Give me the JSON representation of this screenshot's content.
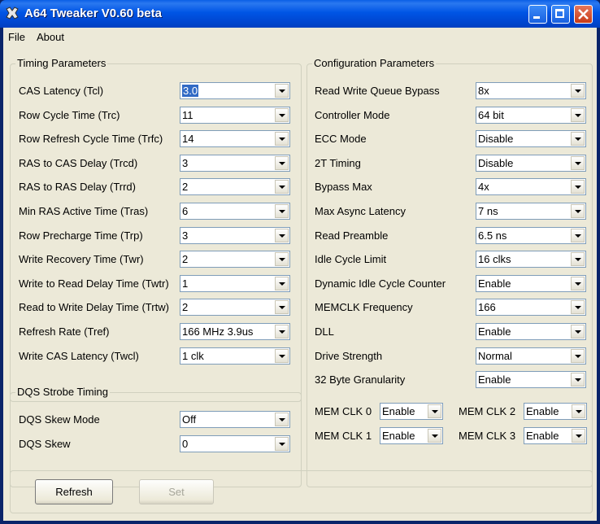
{
  "window": {
    "title": "A64 Tweaker V0.60 beta"
  },
  "menu": [
    "File",
    "About"
  ],
  "timing": {
    "title": "Timing Parameters",
    "rows": [
      {
        "label": "CAS Latency (Tcl)",
        "value": "3.0"
      },
      {
        "label": "Row Cycle Time (Trc)",
        "value": "11"
      },
      {
        "label": "Row Refresh Cycle Time (Trfc)",
        "value": "14"
      },
      {
        "label": "RAS to CAS Delay (Trcd)",
        "value": "3"
      },
      {
        "label": "RAS to RAS Delay (Trrd)",
        "value": "2"
      },
      {
        "label": "Min RAS Active Time (Tras)",
        "value": "6"
      },
      {
        "label": "Row Precharge Time (Trp)",
        "value": "3"
      },
      {
        "label": "Write Recovery Time (Twr)",
        "value": "2"
      },
      {
        "label": "Write to Read Delay Time (Twtr)",
        "value": "1"
      },
      {
        "label": "Read to Write Delay Time (Trtw)",
        "value": "2"
      },
      {
        "label": "Refresh Rate (Tref)",
        "value": "166 MHz 3.9us"
      },
      {
        "label": "Write CAS Latency (Twcl)",
        "value": "1 clk"
      }
    ]
  },
  "dqs": {
    "title": "DQS Strobe Timing",
    "rows": [
      {
        "label": "DQS Skew Mode",
        "value": "Off"
      },
      {
        "label": "DQS Skew",
        "value": "0"
      }
    ]
  },
  "config": {
    "title": "Configuration Parameters",
    "rows": [
      {
        "label": "Read Write Queue Bypass",
        "value": "8x"
      },
      {
        "label": "Controller Mode",
        "value": "64 bit"
      },
      {
        "label": "ECC Mode",
        "value": "Disable"
      },
      {
        "label": "2T Timing",
        "value": "Disable"
      },
      {
        "label": "Bypass Max",
        "value": "4x"
      },
      {
        "label": "Max Async Latency",
        "value": "7 ns"
      },
      {
        "label": "Read Preamble",
        "value": "6.5 ns"
      },
      {
        "label": "Idle Cycle Limit",
        "value": "16 clks"
      },
      {
        "label": "Dynamic Idle Cycle Counter",
        "value": "Enable"
      },
      {
        "label": "MEMCLK Frequency",
        "value": "166"
      },
      {
        "label": "DLL",
        "value": "Enable"
      },
      {
        "label": "Drive Strength",
        "value": "Normal"
      },
      {
        "label": "32 Byte Granularity",
        "value": "Enable"
      }
    ],
    "memclk": [
      {
        "label": "MEM CLK 0",
        "value": "Enable"
      },
      {
        "label": "MEM CLK 2",
        "value": "Enable"
      },
      {
        "label": "MEM CLK 1",
        "value": "Enable"
      },
      {
        "label": "MEM CLK 3",
        "value": "Enable"
      }
    ]
  },
  "buttons": {
    "refresh": "Refresh",
    "set": "Set"
  },
  "colors": {
    "title_bar": "#0055e5",
    "face": "#ece9d8",
    "selection": "#316ac5"
  }
}
